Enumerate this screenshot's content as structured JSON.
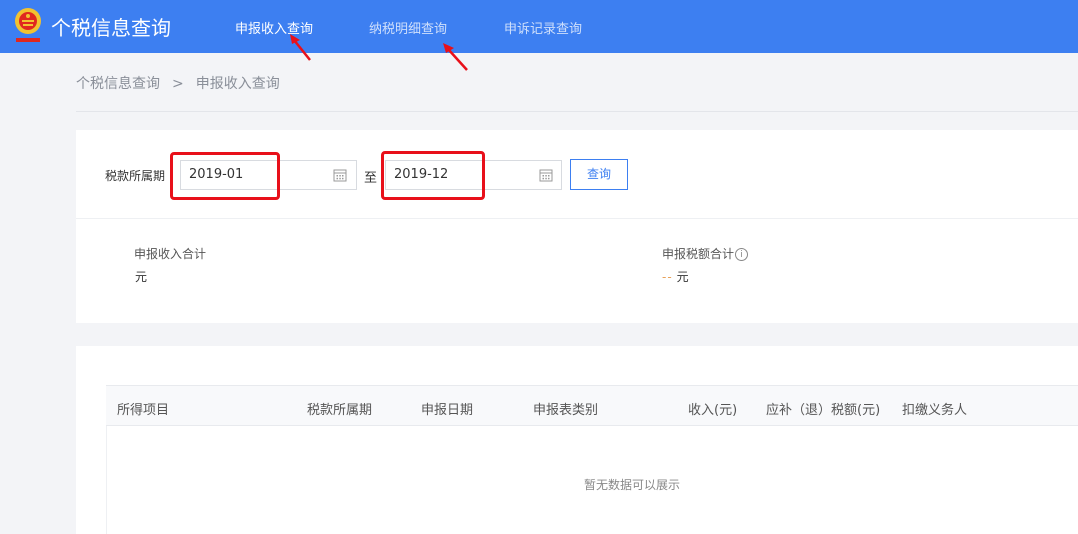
{
  "header": {
    "app_title": "个税信息查询",
    "nav": [
      {
        "label": "申报收入查询",
        "active": true
      },
      {
        "label": "纳税明细查询",
        "active": false
      },
      {
        "label": "申诉记录查询",
        "active": false
      }
    ]
  },
  "breadcrumb": {
    "root": "个税信息查询",
    "separator": ">",
    "current": "申报收入查询"
  },
  "search": {
    "label": "税款所属期",
    "start_value": "2019-01",
    "to_label": "至",
    "end_value": "2019-12",
    "button_label": "查询"
  },
  "summary": {
    "income_label": "申报收入合计",
    "income_unit": "元",
    "tax_label": "申报税额合计",
    "tax_dash": "--",
    "tax_unit": "元",
    "info_glyph": "i"
  },
  "table": {
    "columns": [
      "所得项目",
      "税款所属期",
      "申报日期",
      "申报表类别",
      "收入(元)",
      "应补（退）税额(元)",
      "扣缴义务人"
    ],
    "rows": [],
    "empty_text": "暂无数据可以展示"
  },
  "icons": [
    "emblem-icon",
    "calendar-icon",
    "info-icon"
  ],
  "colors": {
    "header_bg": "#3d7ff1",
    "accent": "#3d7ff1",
    "highlight_red": "#e8101a",
    "dash_orange": "#e8a25b"
  }
}
